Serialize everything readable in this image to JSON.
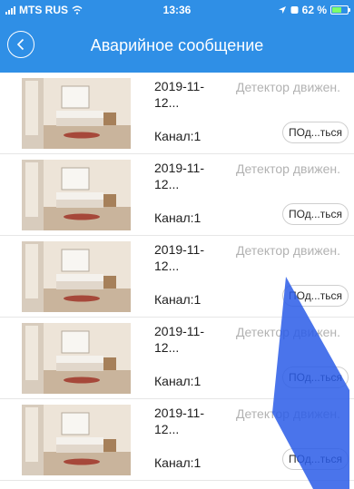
{
  "status_bar": {
    "carrier": "MTS RUS",
    "time": "13:36",
    "battery_text": "62 %",
    "battery_level": 0.62
  },
  "nav": {
    "title": "Аварийное сообщение",
    "back_icon": "chevron-left-icon"
  },
  "alarms": [
    {
      "date": "2019-11-\n12...",
      "type": "Детектор движен.",
      "channel": "Канал:1",
      "action": "ПОд...ться"
    },
    {
      "date": "2019-11-\n12...",
      "type": "Детектор движен.",
      "channel": "Канал:1",
      "action": "ПОд...ться"
    },
    {
      "date": "2019-11-\n12...",
      "type": "Детектор движен.",
      "channel": "Канал:1",
      "action": "ПОд...ться"
    },
    {
      "date": "2019-11-\n12...",
      "type": "Детектор движен.",
      "channel": "Канал:1",
      "action": "ПОд...ться"
    },
    {
      "date": "2019-11-\n12...",
      "type": "Детектор движен.",
      "channel": "Канал:1",
      "action": "ПОд...ться"
    }
  ],
  "colors": {
    "accent": "#2f8fe6",
    "watermark": "#2a5ce8"
  }
}
